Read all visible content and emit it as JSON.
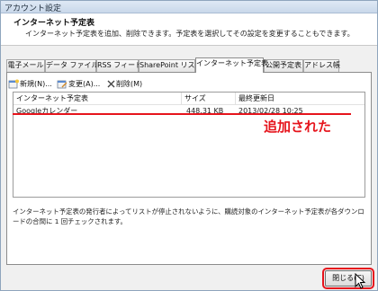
{
  "window": {
    "title": "アカウント設定"
  },
  "header": {
    "title": "インターネット予定表",
    "description": "インターネット予定表を追加、削除できます。予定表を選択してその設定を変更することもできます。"
  },
  "tabs": [
    {
      "label": "電子メール",
      "active": false
    },
    {
      "label": "データ ファイル",
      "active": false
    },
    {
      "label": "RSS フィード",
      "active": false
    },
    {
      "label": "SharePoint リスト",
      "active": false
    },
    {
      "label": "インターネット予定表",
      "active": true
    },
    {
      "label": "公開予定表",
      "active": false
    },
    {
      "label": "アドレス帳",
      "active": false
    }
  ],
  "toolbar": {
    "new_label": "新規(N)...",
    "change_label": "変更(A)...",
    "delete_label": "削除(M)"
  },
  "list": {
    "columns": [
      "インターネット予定表",
      "サイズ",
      "最終更新日"
    ],
    "rows": [
      {
        "name": "Googleカレンダー",
        "size": "448.31 KB",
        "updated": "2013/02/28 10:25"
      }
    ]
  },
  "annotation": {
    "text": "追加された",
    "color": "#e6141c"
  },
  "note": "インターネット予定表の発行者によってリストが停止されないように、購読対象のインターネット予定表が各ダウンロードの合間に 1 回チェックされます。",
  "footer": {
    "close_label": "閉じる(C)"
  }
}
